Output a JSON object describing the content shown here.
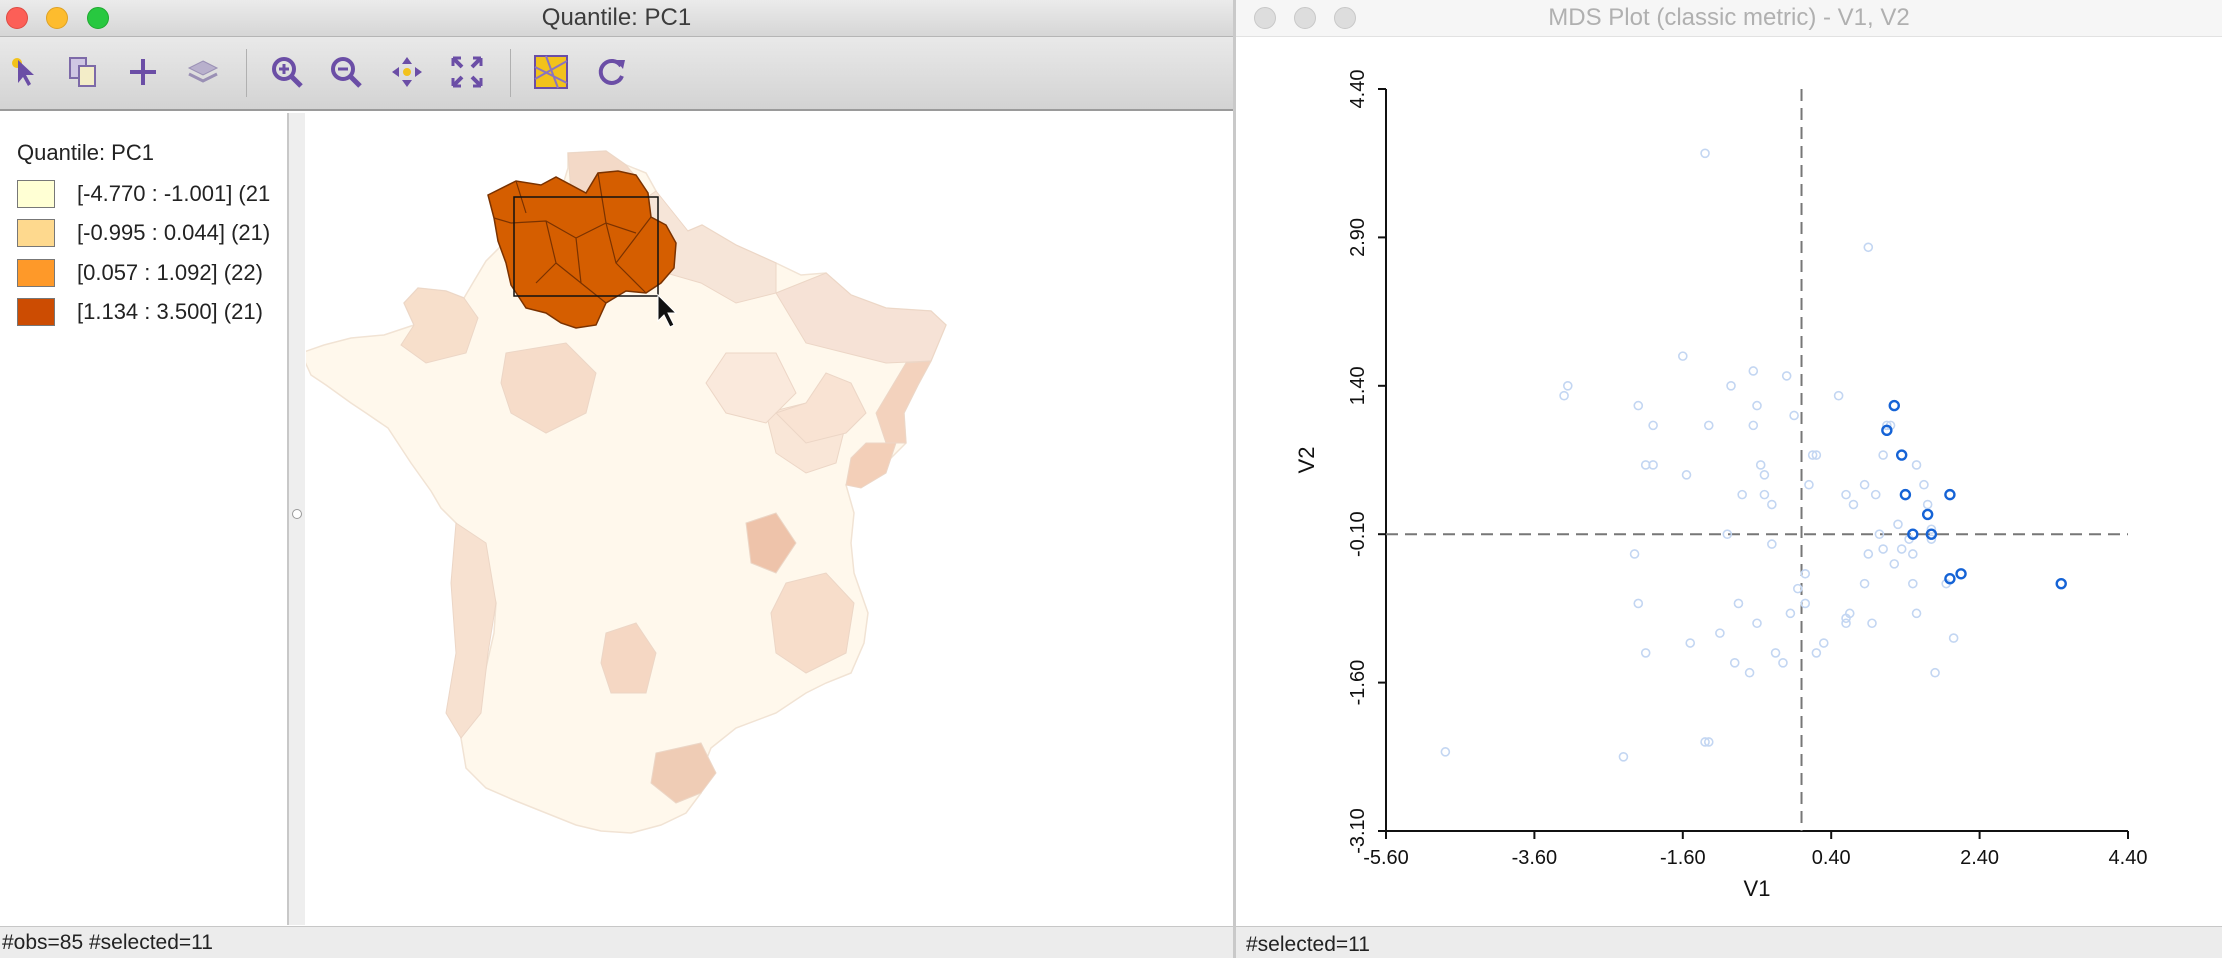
{
  "left_window": {
    "title": "Quantile: PC1",
    "toolbar_icons": [
      "select-arrow-icon",
      "copy-icon",
      "add-plus-icon",
      "layers-icon",
      "zoom-in-icon",
      "zoom-out-icon",
      "pan-icon",
      "full-extent-icon",
      "basemap-icon",
      "refresh-icon"
    ],
    "legend": {
      "title": "Quantile: PC1",
      "items": [
        {
          "label": "[-4.770 : -1.001] (21",
          "color": "#ffffd4"
        },
        {
          "label": "[-0.995 : 0.044] (21)",
          "color": "#fed98e"
        },
        {
          "label": "[0.057 : 1.092] (22)",
          "color": "#fe9929"
        },
        {
          "label": "[1.134 : 3.500] (21)",
          "color": "#cc4c02"
        }
      ]
    },
    "status": "#obs=85 #selected=11"
  },
  "right_window": {
    "title": "MDS Plot (classic metric) - V1, V2",
    "status": "#selected=11"
  },
  "selection_color": "#1563d6",
  "chart_data": {
    "type": "scatter",
    "xlabel": "V1",
    "ylabel": "V2",
    "xlim": [
      -5.6,
      4.4
    ],
    "ylim": [
      -3.1,
      4.4
    ],
    "xticks": [
      "-5.60",
      "-3.60",
      "-1.60",
      "0.40",
      "2.40",
      "4.40"
    ],
    "yticks": [
      "-3.10",
      "-1.60",
      "-0.10",
      "1.40",
      "2.90",
      "4.40"
    ],
    "mean_lines": {
      "x": 0.0,
      "y": -0.1
    },
    "points": [
      [
        -4.8,
        -2.3
      ],
      [
        -3.2,
        1.3
      ],
      [
        -3.15,
        1.4
      ],
      [
        -2.2,
        1.2
      ],
      [
        -2.25,
        -0.3
      ],
      [
        -2.1,
        0.6
      ],
      [
        -2.0,
        0.6
      ],
      [
        -2.0,
        1.0
      ],
      [
        -2.2,
        -0.8
      ],
      [
        -2.1,
        -1.3
      ],
      [
        -2.4,
        -2.35
      ],
      [
        -1.6,
        1.7
      ],
      [
        -1.55,
        0.5
      ],
      [
        -1.5,
        -1.2
      ],
      [
        -1.3,
        -2.2
      ],
      [
        -1.25,
        -2.2
      ],
      [
        -1.25,
        1.0
      ],
      [
        -1.3,
        3.75
      ],
      [
        -1.1,
        -1.1
      ],
      [
        -1.0,
        -0.1
      ],
      [
        -0.95,
        1.4
      ],
      [
        -0.9,
        -1.4
      ],
      [
        -0.85,
        -0.8
      ],
      [
        -0.8,
        0.3
      ],
      [
        -0.7,
        -1.5
      ],
      [
        -0.6,
        1.2
      ],
      [
        -0.65,
        1.0
      ],
      [
        -0.65,
        1.55
      ],
      [
        -0.6,
        -1.0
      ],
      [
        -0.55,
        0.6
      ],
      [
        -0.5,
        0.5
      ],
      [
        -0.5,
        0.3
      ],
      [
        -0.4,
        0.2
      ],
      [
        -0.4,
        -0.2
      ],
      [
        -0.35,
        -1.3
      ],
      [
        -0.25,
        -1.4
      ],
      [
        -0.15,
        -0.9
      ],
      [
        -0.2,
        1.5
      ],
      [
        -0.1,
        1.1
      ],
      [
        -0.05,
        -0.65
      ],
      [
        0.05,
        -0.8
      ],
      [
        0.05,
        -0.5
      ],
      [
        0.1,
        0.4
      ],
      [
        0.15,
        0.7
      ],
      [
        0.2,
        0.7
      ],
      [
        0.2,
        -1.3
      ],
      [
        0.3,
        -1.2
      ],
      [
        0.5,
        1.3
      ],
      [
        0.6,
        -1.0
      ],
      [
        0.6,
        -0.95
      ],
      [
        0.6,
        0.3
      ],
      [
        0.65,
        -0.9
      ],
      [
        0.7,
        0.2
      ],
      [
        0.85,
        0.4
      ],
      [
        0.85,
        -0.6
      ],
      [
        0.9,
        -0.3
      ],
      [
        0.95,
        -1.0
      ],
      [
        1.0,
        0.3
      ],
      [
        1.05,
        -0.1
      ],
      [
        1.1,
        -0.25
      ],
      [
        1.15,
        1.0
      ],
      [
        1.1,
        0.7
      ],
      [
        1.2,
        1.0
      ],
      [
        1.25,
        -0.4
      ],
      [
        1.3,
        0.0
      ],
      [
        1.35,
        -0.25
      ],
      [
        1.45,
        -0.15
      ],
      [
        1.5,
        -0.3
      ],
      [
        1.5,
        -0.6
      ],
      [
        1.55,
        0.6
      ],
      [
        1.55,
        -0.9
      ],
      [
        1.65,
        0.4
      ],
      [
        1.7,
        0.2
      ],
      [
        1.75,
        -0.05
      ],
      [
        1.75,
        -0.15
      ],
      [
        1.8,
        -1.5
      ],
      [
        1.95,
        -0.6
      ],
      [
        2.05,
        -1.15
      ],
      [
        0.9,
        2.8
      ]
    ],
    "selected_points": [
      [
        1.25,
        1.2
      ],
      [
        1.15,
        0.95
      ],
      [
        1.35,
        0.7
      ],
      [
        1.4,
        0.3
      ],
      [
        2.0,
        0.3
      ],
      [
        1.7,
        0.1
      ],
      [
        1.5,
        -0.1
      ],
      [
        1.75,
        -0.1
      ],
      [
        2.0,
        -0.55
      ],
      [
        2.15,
        -0.5
      ],
      [
        3.5,
        -0.6
      ]
    ]
  }
}
